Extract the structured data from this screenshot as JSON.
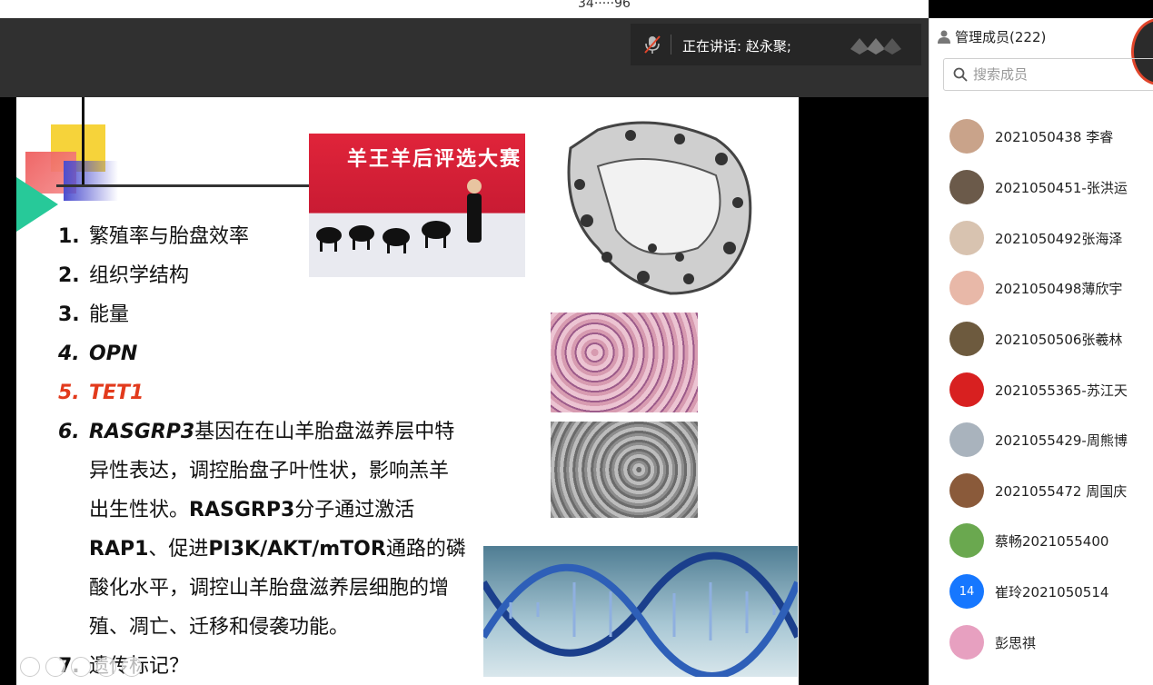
{
  "top": {
    "page_indicator": "34·····96"
  },
  "header": {
    "speaker_label": "正在讲话: 赵永聚;"
  },
  "slide": {
    "items": [
      {
        "num": "1.",
        "text": "繁殖率与胎盘效率"
      },
      {
        "num": "2.",
        "text": "组织学结构"
      },
      {
        "num": "3.",
        "text": "能量"
      },
      {
        "num": "4.",
        "text": "OPN"
      },
      {
        "num": "5.",
        "text": "TET1"
      },
      {
        "num": "6.",
        "text_a": "RASGRP3",
        "text_b": "基因在在山羊胎盘滋养层中特异性表达，调控胎盘子叶性状，影响羔羊出生性状。",
        "text_c": "RASGRP3",
        "text_d": "分子通过激活",
        "text_e": "RAP1",
        "text_f": "、促进",
        "text_g": "PI3K/AKT/mTOR",
        "text_h": "通路的磷酸化水平，调控山羊胎盘滋养层细胞的增殖、凋亡、迁移和侵袭功能。"
      },
      {
        "num": "7.",
        "text": "遗传标记？"
      }
    ],
    "event_banner": "羊王羊后评选大赛",
    "accent_red": "#e23a1c"
  },
  "panel": {
    "title": "管理成员(222)",
    "search_placeholder": "搜索成员",
    "members": [
      {
        "name": "2021050438 李睿",
        "avatar_color": "#c9a38a"
      },
      {
        "name": "2021050451-张洪运",
        "avatar_color": "#6b5a4a"
      },
      {
        "name": "2021050492张海泽",
        "avatar_color": "#d8c3b0"
      },
      {
        "name": "2021050498薄欣宇",
        "avatar_color": "#e8b8a8"
      },
      {
        "name": "2021050506张羲林",
        "avatar_color": "#6d5a3e"
      },
      {
        "name": "2021055365-苏江天",
        "avatar_color": "#d82020"
      },
      {
        "name": "2021055429-周熊博",
        "avatar_color": "#a9b3bd"
      },
      {
        "name": "2021055472 周国庆",
        "avatar_color": "#8a5a3a"
      },
      {
        "name": "蔡畅2021055400",
        "avatar_color": "#6aa84f"
      },
      {
        "name": "崔玲2021050514",
        "avatar_color": "#1677ff",
        "avatar_text": "14"
      },
      {
        "name": "彭思祺",
        "avatar_color": "#e7a0c0"
      }
    ]
  }
}
